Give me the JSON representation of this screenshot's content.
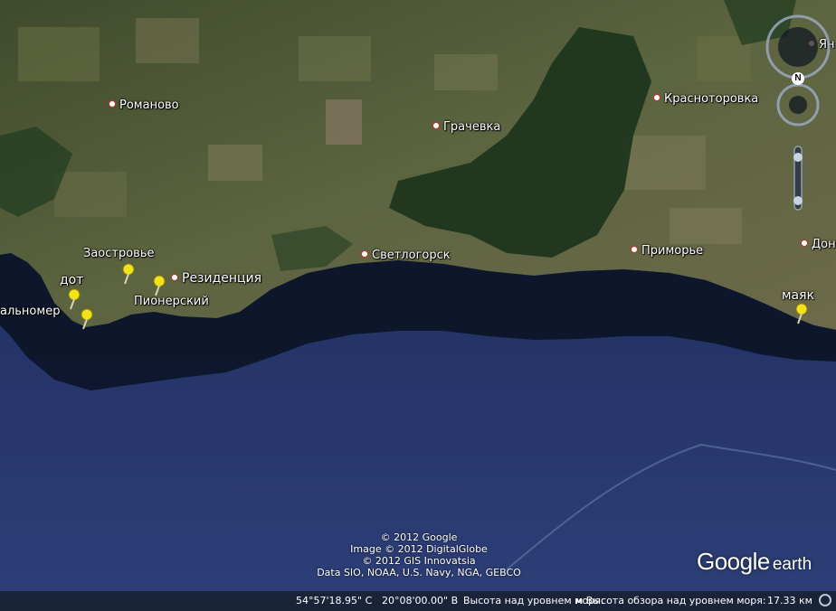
{
  "places": [
    {
      "name": "Романово",
      "id": "romanovo"
    },
    {
      "name": "Грачевка",
      "id": "grachevka"
    },
    {
      "name": "Красноторовка",
      "id": "krasnotorovka"
    },
    {
      "name": "Светлогорск",
      "id": "svetlogorsk"
    },
    {
      "name": "Приморье",
      "id": "primorye"
    },
    {
      "name": "Дон",
      "id": "don"
    },
    {
      "name": "Ян",
      "id": "yan"
    },
    {
      "name": "Пионерский",
      "id": "pionersky"
    },
    {
      "name": "Заостровье",
      "id": "zaostrovye"
    },
    {
      "name": "альномер",
      "id": "filino"
    }
  ],
  "placemarks": [
    {
      "label": "дот",
      "id": "dot"
    },
    {
      "label": "Резиденция",
      "id": "residence"
    },
    {
      "label": "маяк",
      "id": "mayak"
    }
  ],
  "credits": [
    "© 2012 Google",
    "Image © 2012 DigitalGlobe",
    "© 2012 GIS Innovatsia",
    "Data SIO, NOAA, U.S. Navy, NGA, GEBCO"
  ],
  "brand": {
    "google": "Google",
    "earth": "earth"
  },
  "status": {
    "latitude": "54°57'18.95\" С",
    "longitude": "20°08'00.00\" В",
    "elevation": "Высота над уровнем моря:",
    "eye_alt_label": "м  Высота обзора над уровнем моря:",
    "eye_alt": "17.33 км"
  },
  "nav": {
    "north": "N"
  },
  "colors": {
    "sea": "#1e2c52",
    "land": "#4e5a33",
    "forest": "#1f3a1e",
    "pin": "#f2e21a"
  }
}
